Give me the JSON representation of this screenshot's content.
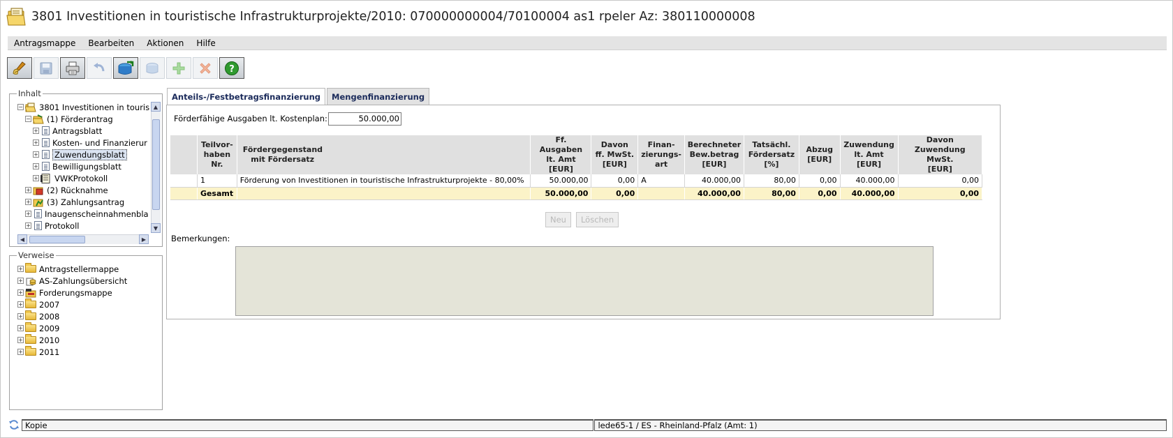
{
  "window": {
    "title": "3801 Investitionen in touristische Infrastrukturprojekte/2010: 070000000004/70100004 as1 rpeler Az: 380110000008"
  },
  "menu": [
    "Antragsmappe",
    "Bearbeiten",
    "Aktionen",
    "Hilfe"
  ],
  "toolbar": [
    {
      "icon": "broom-edit-icon",
      "state": "active"
    },
    {
      "icon": "save-icon",
      "state": "disabled"
    },
    {
      "icon": "print-icon",
      "state": "active"
    },
    {
      "icon": "undo-icon",
      "state": "disabled"
    },
    {
      "icon": "database-transfer-icon",
      "state": "active"
    },
    {
      "icon": "database-icon",
      "state": "disabled"
    },
    {
      "icon": "add-icon",
      "state": "disabled"
    },
    {
      "icon": "delete-icon",
      "state": "disabled"
    },
    {
      "icon": "help-icon",
      "state": "active"
    }
  ],
  "inhalt": {
    "legend": "Inhalt",
    "items": [
      {
        "label": "3801 Investitionen in touristi",
        "icon": "folder-open-icon"
      },
      {
        "label": "(1) Förderantrag",
        "icon": "folder-open-icon"
      },
      {
        "label": "Antragsblatt",
        "icon": "document-icon"
      },
      {
        "label": "Kosten- und Finanzierur",
        "icon": "document-icon"
      },
      {
        "label": "Zuwendungsblatt",
        "icon": "document-icon",
        "selected": true
      },
      {
        "label": "Bewilligungsblatt",
        "icon": "document-icon"
      },
      {
        "label": "VWKProtokoll",
        "icon": "protocol-icon"
      },
      {
        "label": "(2) Rücknahme",
        "icon": "folder-red-icon"
      },
      {
        "label": "(3) Zahlungsantrag",
        "icon": "folder-green-icon"
      },
      {
        "label": "Inaugenscheinnahmenbla",
        "icon": "document-icon"
      },
      {
        "label": "Protokoll",
        "icon": "document-icon"
      }
    ]
  },
  "verweise": {
    "legend": "Verweise",
    "items": [
      {
        "label": "Antragstellermappe",
        "icon": "folder-icon"
      },
      {
        "label": "AS-Zahlungsübersicht",
        "icon": "coins-icon"
      },
      {
        "label": "Forderungsmappe",
        "icon": "claim-folder-icon"
      },
      {
        "label": "2007",
        "icon": "folder-icon"
      },
      {
        "label": "2008",
        "icon": "folder-icon"
      },
      {
        "label": "2009",
        "icon": "folder-icon"
      },
      {
        "label": "2010",
        "icon": "folder-icon"
      },
      {
        "label": "2011",
        "icon": "folder-icon"
      }
    ]
  },
  "tabs": [
    "Anteils-/Festbetragsfinanzierung",
    "Mengenfinanzierung"
  ],
  "form": {
    "plan_label": "Förderfähige Ausgaben lt. Kostenplan:",
    "plan_value": "50.000,00",
    "remarks_label": "Bemerkungen:",
    "buttons": [
      "Neu",
      "Löschen"
    ]
  },
  "table": {
    "headers": [
      "",
      "Teilvor-\nhaben\nNr.",
      "Fördergegenstand\n   mit Fördersatz",
      "Ff. Ausgaben\nlt. Amt\n[EUR]",
      "Davon\nff. MwSt.\n[EUR]",
      "Finan-\nzierungs-\nart",
      "Berechneter\nBew.betrag\n[EUR]",
      "Tatsächl.\nFördersatz\n[%]",
      "Abzug\n[EUR]",
      "Zuwendung\nlt. Amt\n[EUR]",
      "Davon\nZuwendung MwSt.\n[EUR]"
    ],
    "rows": [
      [
        "",
        "1",
        "Förderung von Investitionen in touristische Infrastrukturprojekte - 80,00%",
        "50.000,00",
        "0,00",
        "A",
        "40.000,00",
        "80,00",
        "0,00",
        "40.000,00",
        "0,00"
      ]
    ],
    "total": [
      "",
      "Gesamt",
      "",
      "50.000,00",
      "0,00",
      "",
      "40.000,00",
      "80,00",
      "0,00",
      "40.000,00",
      "0,00"
    ]
  },
  "status": {
    "left": "Kopie",
    "right": "lede65-1 / ES - Rheinland-Pfalz (Amt: 1)"
  }
}
